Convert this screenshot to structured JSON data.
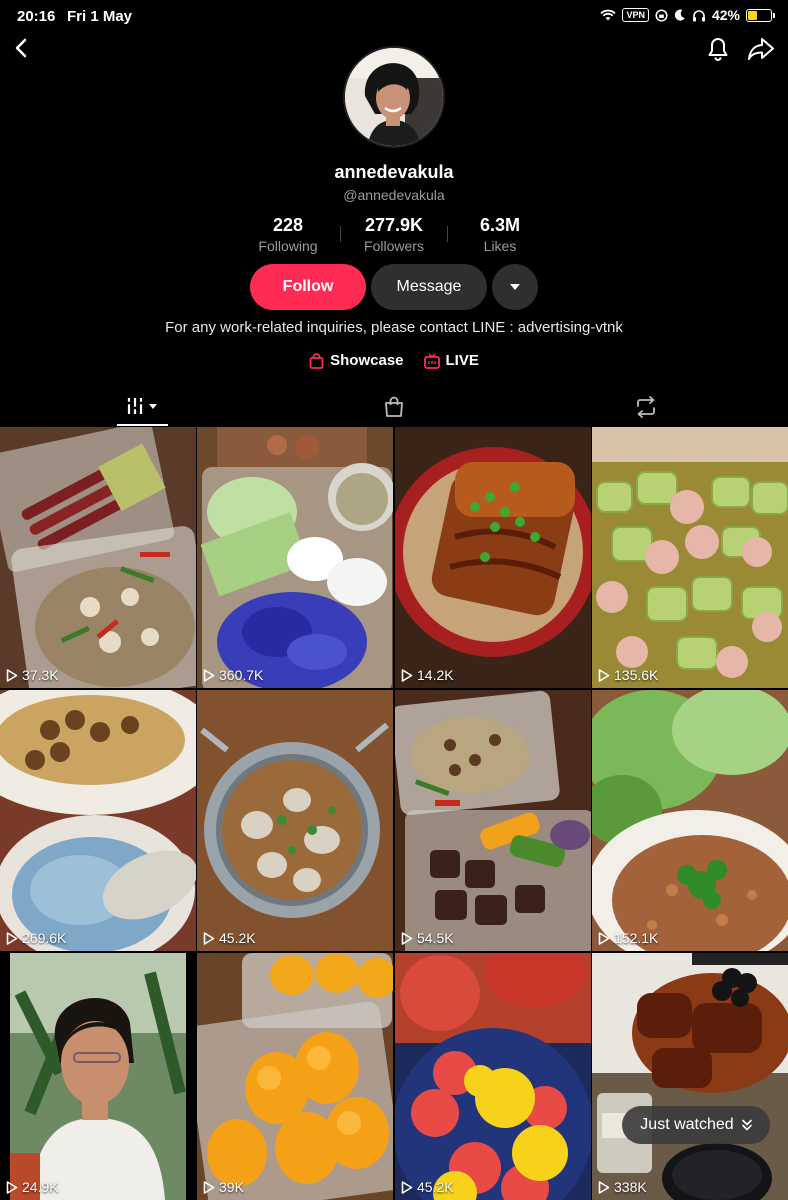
{
  "status_bar": {
    "time": "20:16",
    "date": "Fri 1 May",
    "vpn": "VPN",
    "battery": "42%"
  },
  "profile": {
    "display_name": "annedevakula",
    "handle": "@annedevakula",
    "stats": [
      {
        "value": "228",
        "label": "Following"
      },
      {
        "value": "277.9K",
        "label": "Followers"
      },
      {
        "value": "6.3M",
        "label": "Likes"
      }
    ],
    "follow_label": "Follow",
    "message_label": "Message",
    "bio": "For any work-related inquiries, please contact LINE : advertising-vtnk",
    "links": [
      {
        "label": "Showcase",
        "icon": "shopping-bag-icon"
      },
      {
        "label": "LIVE",
        "icon": "live-tv-icon"
      }
    ]
  },
  "tabs": [
    {
      "name": "videos",
      "icon": "grid-sort-icon",
      "active": true
    },
    {
      "name": "shop",
      "icon": "shopping-bag-icon",
      "active": false
    },
    {
      "name": "reposts",
      "icon": "repost-icon",
      "active": false
    }
  ],
  "videos": [
    {
      "views": "37.3K"
    },
    {
      "views": "360.7K"
    },
    {
      "views": "14.2K"
    },
    {
      "views": "135.6K"
    },
    {
      "views": "269.6K"
    },
    {
      "views": "45.2K"
    },
    {
      "views": "54.5K"
    },
    {
      "views": "152.1K"
    },
    {
      "views": "24.9K"
    },
    {
      "views": "39K"
    },
    {
      "views": "45.2K"
    },
    {
      "views": "338K"
    }
  ],
  "just_watched_label": "Just watched",
  "colors": {
    "accent": "#fe2c55",
    "background": "#000000",
    "secondary_button": "#2f2f2f"
  }
}
